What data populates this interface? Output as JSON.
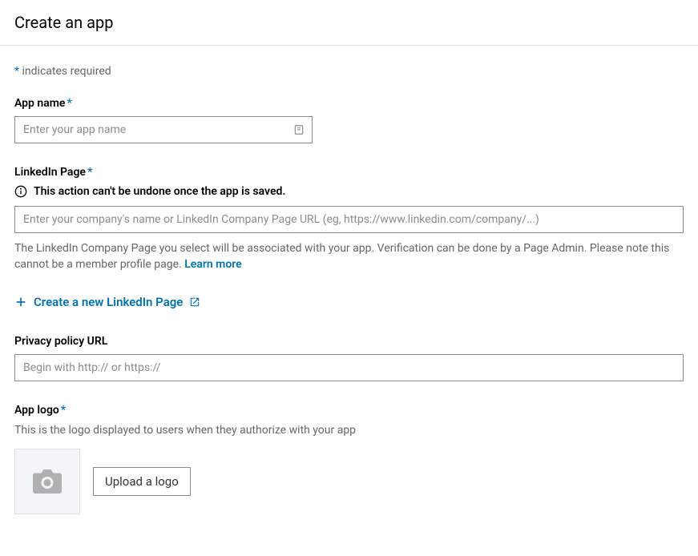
{
  "header": {
    "title": "Create an app"
  },
  "required_note": {
    "asterisk": "*",
    "text": " indicates required"
  },
  "app_name": {
    "label": "App name",
    "placeholder": "Enter your app name"
  },
  "linkedin_page": {
    "label": "LinkedIn Page",
    "warning": "This action can't be undone once the app is saved.",
    "placeholder": "Enter your company's name or LinkedIn Company Page URL (eg, https://www.linkedin.com/company/...)",
    "help_text": "The LinkedIn Company Page you select will be associated with your app. Verification can be done by a Page Admin. Please note this cannot be a member profile page. ",
    "learn_more": "Learn more",
    "create_link": "Create a new LinkedIn Page"
  },
  "privacy_policy": {
    "label": "Privacy policy URL",
    "placeholder": "Begin with http:// or https://"
  },
  "app_logo": {
    "label": "App logo",
    "description": "This is the logo displayed to users when they authorize with your app",
    "upload_button": "Upload a logo"
  }
}
